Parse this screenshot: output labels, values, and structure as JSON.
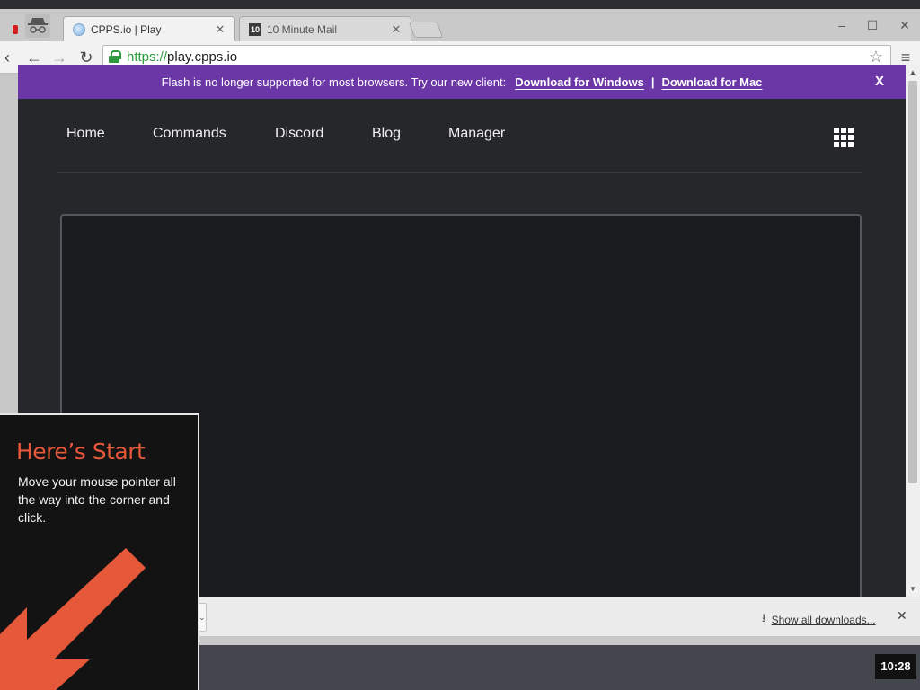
{
  "browser": {
    "tabs": [
      {
        "title": "CPPS.io | Play",
        "active": true
      },
      {
        "title": "10 Minute Mail",
        "active": false,
        "favicon_text": "10"
      }
    ],
    "window_controls": {
      "minimize": "–",
      "maximize": "☐",
      "close": "✕"
    },
    "nav": {
      "back": "←",
      "forward": "→",
      "reload": "↻"
    },
    "url": {
      "scheme": "https://",
      "rest": "play.cpps.io"
    },
    "star": "☆",
    "menu": "≡"
  },
  "banner": {
    "message": "Flash is no longer supported for most browsers. Try our new client:",
    "link_windows": "Download for Windows",
    "separator": "|",
    "link_mac": "Download for Mac",
    "close": "X",
    "color": "#6b36a6"
  },
  "site_nav": {
    "items": [
      "Home",
      "Commands",
      "Discord",
      "Blog",
      "Manager"
    ],
    "apps_icon": "grid-icon"
  },
  "downloads": {
    "show_all": "Show all downloads...",
    "close": "✕"
  },
  "taskbar": {
    "clock": "10:28"
  },
  "start_tip": {
    "title": "Here’s Start",
    "body": "Move your mouse pointer all the way into the corner and click.",
    "accent": "#e5583a"
  }
}
